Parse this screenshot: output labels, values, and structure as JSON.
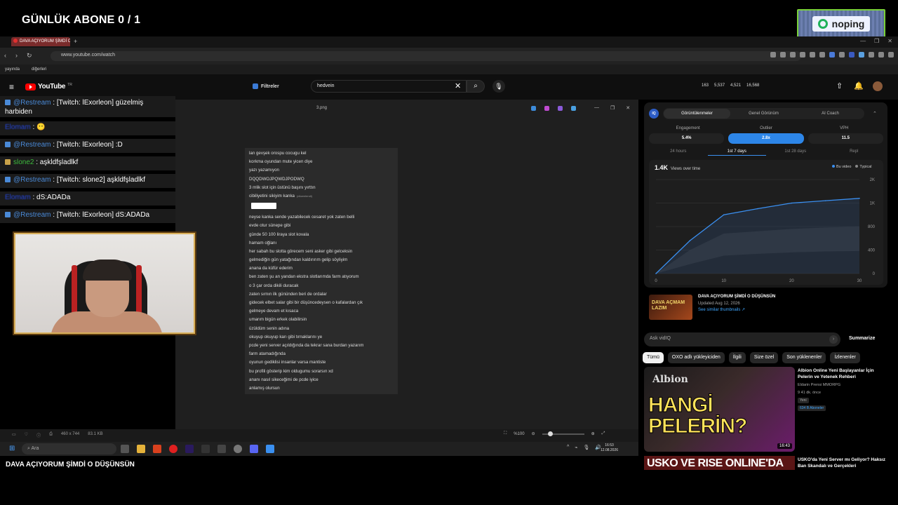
{
  "overlay": {
    "title": "GÜNLÜK ABONE 0 / 1",
    "noping": "noping"
  },
  "browser": {
    "tab_title": "DAVA AÇIYORUM ŞİMDİ O",
    "url": "www.youtube.com/watch",
    "bookmarks": [
      "yayında",
      "diğerleri"
    ]
  },
  "youtube": {
    "logo": "YouTube",
    "region": "TR",
    "filter_label": "Filtreler",
    "search_value": "hedvein",
    "stats": [
      "163",
      "5,537",
      "4,521",
      "16,568"
    ]
  },
  "viewer": {
    "filename": "3.png",
    "doc_lines": [
      "lan gevşek orospu cocugu kel",
      "korkma oyundan mute yicen diye",
      "yazı yazamıyon",
      "DQQDWOJPQWDJPODWQ",
      "3 mlik slot için üstünü başını yırttın",
      "cibiliyetini sikiyim kanka"
    ],
    "doc_edited": "(düzenlendi)",
    "doc_lines_2": [
      "neyse kanka sende yazabilecek cesaret yok zaten belli",
      "evde otur sünepe gibi",
      "günde 50 100 liraya slot kovala",
      "hamam oğlanı",
      "her sabah bu slotta görecem seni asker gibi gelceksin",
      "gelmediğin gün yatağından kaldırırım gelip söyliyim",
      "anana da küfür ederim",
      "ben zaten şu an yandan ekstra slotlarımda farm atıyorum",
      "o 3 çar orda dikili duracak",
      "zaten sırnın ilk gününden beri de ordalar",
      "gidecek elbet salar gibi bir düşüncedeysen o kafalardan çık",
      "gelmeye devam et kısaca",
      "umarım bigün erkek olabilirsin",
      "üzüldüm senin adına",
      "okuyup okuyup karı gibi tırnaklarını ye",
      "pcde yeni server açıldığında da tekrar sana burdan yazarım",
      "farm atamadığında",
      "oyunun gediklisi insanlar varsa mantiste",
      "bu profili gösterip kim oldugumu sorarsın xd",
      "ananı nasıl sikeceğimi de pcde iyice",
      "anlamış olursun"
    ],
    "dims": "460 x 744",
    "size": "83.1 KB",
    "zoom": "%100"
  },
  "chat": [
    {
      "user": "@Restream",
      "text": ": [Twitch: lExorleon] güzelmiş harbiden"
    },
    {
      "user": "Elomam",
      "text": ": 😶"
    },
    {
      "user": "@Restream",
      "text": ": [Twitch: lExorleon] :D"
    },
    {
      "user": "slone2",
      "text": ": aşkldfşladlkf"
    },
    {
      "user": "@Restream",
      "text": ": [Twitch: slone2] aşkldfşladlkf"
    },
    {
      "user": "Elomam",
      "text": ": dS:ADADa"
    },
    {
      "user": "@Restream",
      "text": ": [Twitch: lExorleon] dS:ADADa"
    }
  ],
  "panel": {
    "tabs": [
      "Görüntülenmeler",
      "Genel Görünüm",
      "AI Coach"
    ],
    "metrics": [
      {
        "label": "Engagement",
        "value": "5.4%"
      },
      {
        "label": "Outlier",
        "value": "2.8x"
      },
      {
        "label": "VPH",
        "value": "11.5"
      }
    ],
    "periods": [
      "24 hours",
      "1st 7 days",
      "1st 28 days",
      "Repl"
    ],
    "chart_title": "1.4K",
    "chart_subtitle": "Views over time",
    "legend": [
      "Bu video",
      "Typical"
    ],
    "y_ticks": [
      "2K",
      "1K",
      "800",
      "400",
      "0"
    ],
    "x_ticks": [
      "0",
      "10",
      "20",
      "30"
    ],
    "video": {
      "thumb_text": "DAVA AÇMAM LAZIM",
      "title": "DAVA AÇIYORUM ŞİMDİ O DÜŞÜNSÜN",
      "date": "Updated Aug 12, 2026",
      "link": "See similar thumbnails ↗"
    }
  },
  "ask": {
    "placeholder": "Ask vidIQ",
    "summarize": "Summarize"
  },
  "chips": [
    "Tümü",
    "OXO adlı yükleyiciden",
    "İlgili",
    "Size özel",
    "Son yüklenenler",
    "İzlenenler"
  ],
  "recs": [
    {
      "brand": "Albion",
      "big": "HANGİ PELERİN?",
      "time": "16:43",
      "title": "Albion Online Yeni Başlayanlar İçin Pelerin ve Yetenek Rehberi",
      "channel": "Eldarin Prensi MMORPG",
      "views": "9  41 dk. önce",
      "badge": "Yeni",
      "subs": "634 B Aboneler"
    },
    {
      "big": "USKO VE RISE ONLINE'DA",
      "title": "USKO'da Yeni Server mı Geliyor? Haksız Ban Skandalı ve Gerçekleri"
    }
  ],
  "taskbar": {
    "search": "Ara",
    "time": "16:53",
    "date": "12.08.2026"
  },
  "bottom_title": "DAVA AÇIYORUM ŞİMDİ O DÜŞÜNSÜN",
  "chart_data": {
    "type": "area",
    "title": "1.4K",
    "x": [
      0,
      5,
      10,
      15,
      20,
      25,
      30
    ],
    "series": [
      {
        "name": "Bu video",
        "values": [
          0,
          700,
          1250,
          1380,
          1500,
          1550,
          1600
        ]
      }
    ],
    "typical_band": {
      "upper": [
        0,
        500,
        850,
        900,
        950,
        980,
        1000
      ],
      "lower": [
        0,
        200,
        380,
        420,
        450,
        470,
        480
      ]
    },
    "xlim": [
      0,
      30
    ],
    "ylim": [
      0,
      2000
    ],
    "accent_color": "#3a8ff0"
  }
}
